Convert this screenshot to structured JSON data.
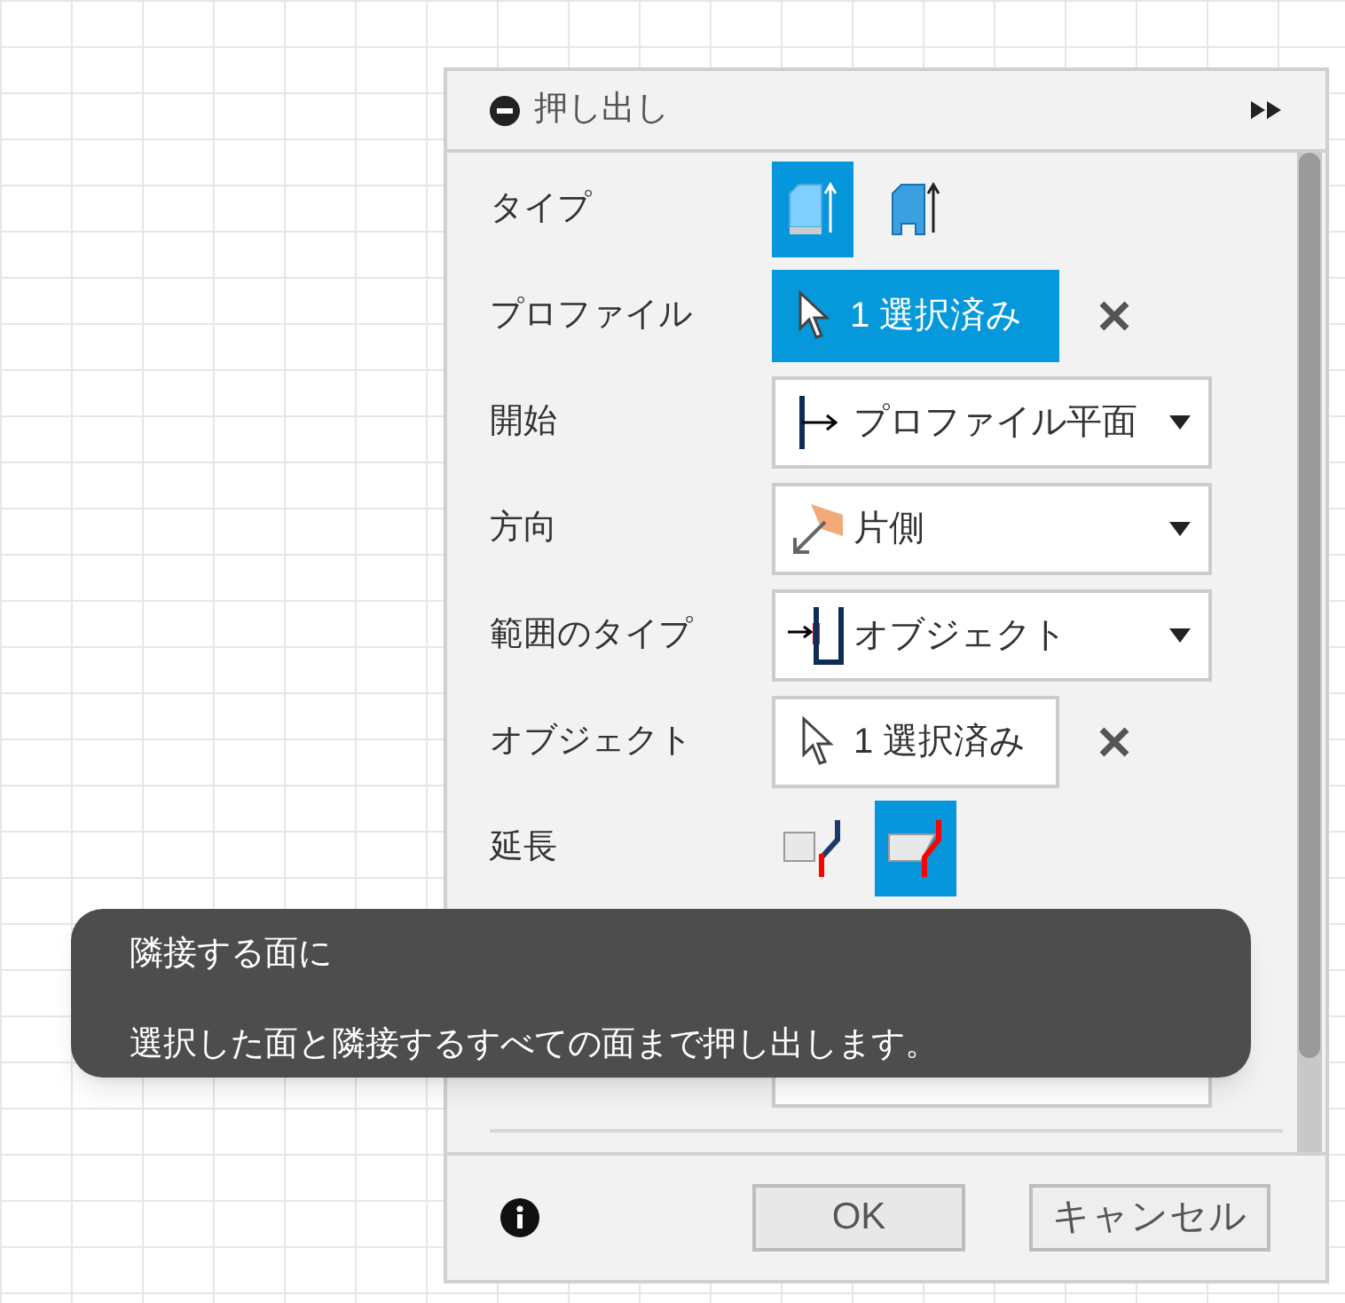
{
  "dialog": {
    "title": "押し出し"
  },
  "rows": [
    {
      "kind": "icons",
      "label": "タイプ",
      "options": [
        {
          "selected": true
        },
        {
          "selected": false
        }
      ]
    },
    {
      "kind": "selection",
      "label": "プロファイル",
      "value": "1 選択済み",
      "active": true
    },
    {
      "kind": "dropdown",
      "label": "開始",
      "value": "プロファイル平面"
    },
    {
      "kind": "dropdown",
      "label": "方向",
      "value": "片側"
    },
    {
      "kind": "dropdown",
      "label": "範囲のタイプ",
      "value": "オブジェクト"
    },
    {
      "kind": "selection",
      "label": "オブジェクト",
      "value": "1 選択済み",
      "active": false
    },
    {
      "kind": "icons",
      "label": "延長",
      "options": [
        {
          "selected": false
        },
        {
          "selected": true
        }
      ]
    }
  ],
  "tooltip": {
    "title": "隣接する面に",
    "text": "選択した面と隣接するすべての面まで押し出します。"
  },
  "buttons": {
    "ok": "OK",
    "cancel": "キャンセル"
  }
}
